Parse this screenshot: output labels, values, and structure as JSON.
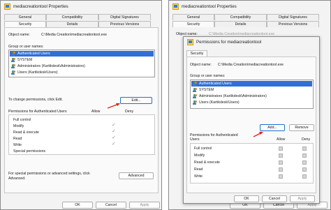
{
  "left": {
    "title": "mediacreationtool Properties",
    "tabs_row1": [
      "General",
      "Compatibility",
      "Digital Signatures"
    ],
    "tabs_row2": [
      "Security",
      "Details",
      "Previous Versions"
    ],
    "object_label": "Object name:",
    "object_value": "C:\\Media Creation\\mediacreationtool.exe",
    "group_label": "Group or user names:",
    "users": [
      "Authenticated Users",
      "SYSTEM",
      "Administrators (Kartikdesk\\Administrators)",
      "Users (Kartikdesk\\Users)"
    ],
    "change_text": "To change permissions, click Edit.",
    "edit_button": "Edit...",
    "perm_header": "Permissions for Authenticated Users",
    "allow": "Allow",
    "deny": "Deny",
    "permissions": [
      "Full control",
      "Modify",
      "Read & execute",
      "Read",
      "Write",
      "Special permissions"
    ],
    "advanced_text_1": "For special permissions or advanced settings, click",
    "advanced_text_2": "Advanced.",
    "advanced_button": "Advanced",
    "buttons": [
      "OK",
      "Cancel",
      "Apply"
    ]
  },
  "right_bg": {
    "title": "mediacreationtool Properties",
    "tabs_row1": [
      "General",
      "Compatibility",
      "Digital Signatures"
    ],
    "tabs_row2": [
      "Security",
      "Details",
      "Previous Versions"
    ],
    "object_label": "Object name:",
    "object_value": "C:\\Media Creation\\mediacreationtool.exe",
    "buttons": [
      "OK",
      "Cancel",
      "Apply"
    ]
  },
  "dialog": {
    "title": "Permissions for mediacreationtool",
    "tab": "Security",
    "object_label": "Object name:",
    "object_value": "C:\\Media Creation\\mediacreationtool.exe",
    "group_label": "Group or user names:",
    "users": [
      "Authenticated Users",
      "SYSTEM",
      "Administrators (Kartikdesk\\Administrators)",
      "Users (Kartikdesk\\Users)"
    ],
    "add_button": "Add...",
    "remove_button": "Remove",
    "perm_header_1": "Permissions for Authenticated",
    "perm_header_2": "Users",
    "allow": "Allow",
    "deny": "Deny",
    "permissions": [
      "Full control",
      "Modify",
      "Read & execute",
      "Read",
      "Write"
    ],
    "buttons": [
      "OK",
      "Cancel",
      "Apply"
    ]
  },
  "colors": {
    "accent": "#2f6fd6",
    "arrow": "#e02020"
  }
}
